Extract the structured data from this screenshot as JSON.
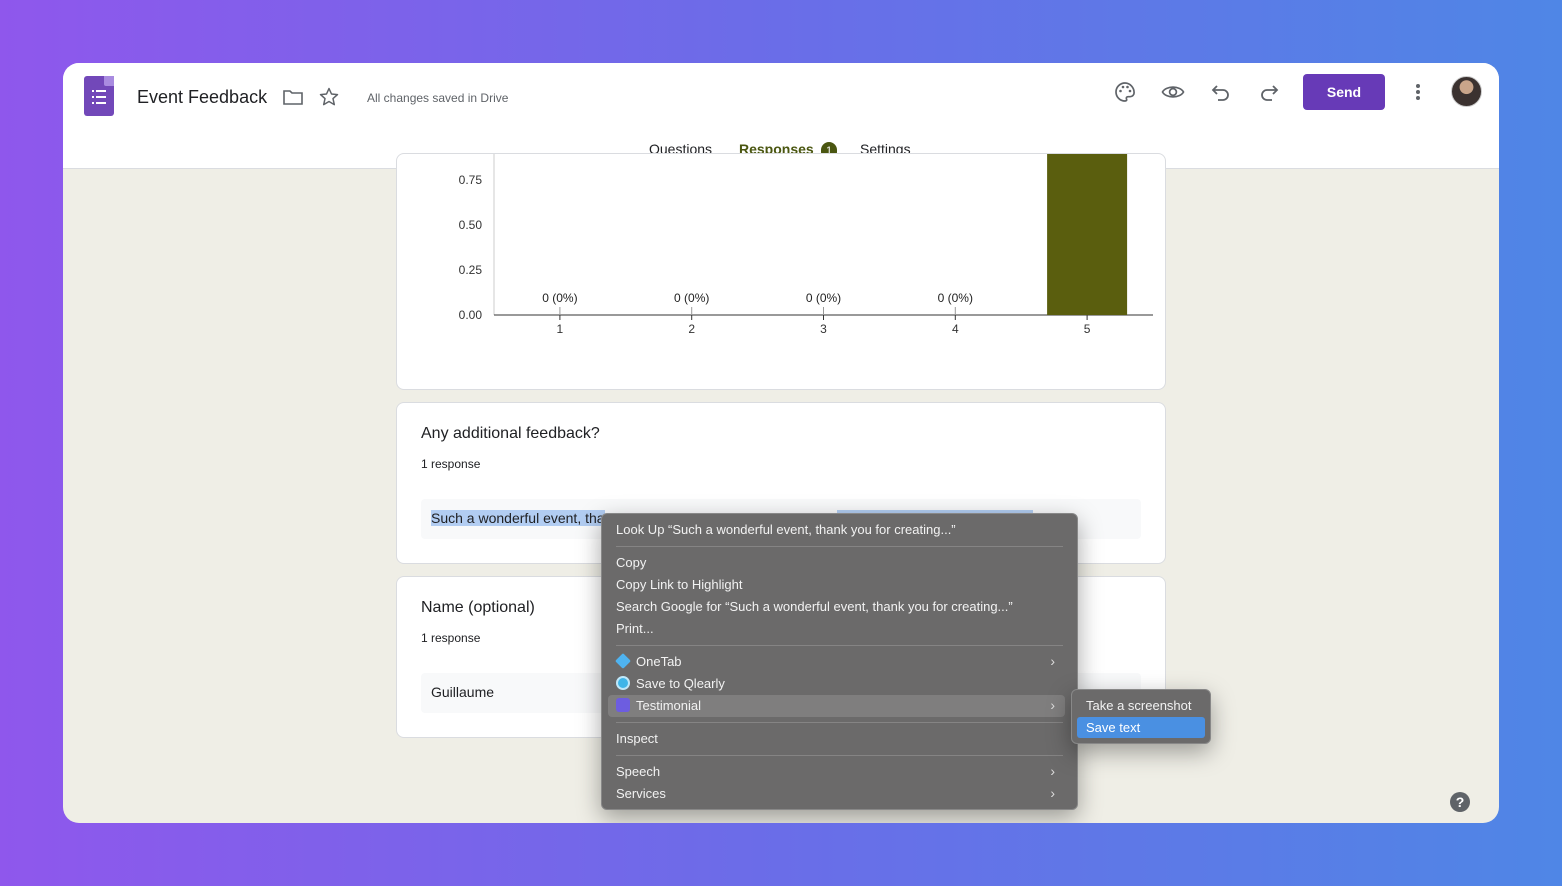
{
  "header": {
    "title": "Event Feedback",
    "saved_status": "All changes saved in Drive",
    "send_label": "Send"
  },
  "tabs": [
    {
      "label": "Questions"
    },
    {
      "label": "Responses",
      "badge": "1"
    },
    {
      "label": "Settings"
    }
  ],
  "chart_data": {
    "type": "bar",
    "categories": [
      "1",
      "2",
      "3",
      "4",
      "5"
    ],
    "values": [
      0,
      0,
      0,
      0,
      1
    ],
    "data_labels": [
      "0 (0%)",
      "0 (0%)",
      "0 (0%)",
      "0 (0%)",
      ""
    ],
    "yticks": [
      "0.75",
      "0.50",
      "0.25",
      "0.00"
    ],
    "bar_color": "#5a5e0e"
  },
  "cards": {
    "feedback": {
      "title": "Any additional feedback?",
      "count": "1 response",
      "answer_visible": "Such a wonderful event, tha"
    },
    "name": {
      "title": "Name (optional)",
      "count": "1 response",
      "answer": "Guillaume"
    }
  },
  "context_menu": {
    "look_up": "Look Up “Such a wonderful event, thank you for creating...”",
    "copy": "Copy",
    "copy_link": "Copy Link to Highlight",
    "search_google": "Search Google for “Such a wonderful event, thank you for creating...”",
    "print": "Print...",
    "onetab": "OneTab",
    "qlearly": "Save to Qlearly",
    "testimonial": "Testimonial",
    "inspect": "Inspect",
    "speech": "Speech",
    "services": "Services"
  },
  "submenu": {
    "screenshot": "Take a screenshot",
    "save_text": "Save text"
  },
  "help": "?"
}
